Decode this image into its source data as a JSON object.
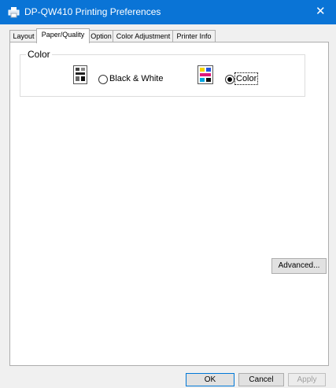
{
  "window": {
    "title": "DP-QW410 Printing Preferences",
    "close_glyph": "✕",
    "icon": "printer-icon"
  },
  "tabs": [
    {
      "label": "Layout",
      "active": false
    },
    {
      "label": "Paper/Quality",
      "active": true
    },
    {
      "label": "Option",
      "active": false
    },
    {
      "label": "Color Adjustment",
      "active": false
    },
    {
      "label": "Printer Info",
      "active": false
    }
  ],
  "color_group": {
    "legend": "Color",
    "options": [
      {
        "label": "Black & White",
        "checked": false,
        "icon": "black-white-page-icon"
      },
      {
        "label": "Color",
        "checked": true,
        "icon": "color-page-icon"
      }
    ]
  },
  "advanced_button": "Advanced...",
  "footer": {
    "ok": "OK",
    "cancel": "Cancel",
    "apply": "Apply"
  },
  "colors": {
    "titlebar": "#0a74d6",
    "window_bg": "#f0f0f0",
    "button_default_border": "#0078d7"
  }
}
